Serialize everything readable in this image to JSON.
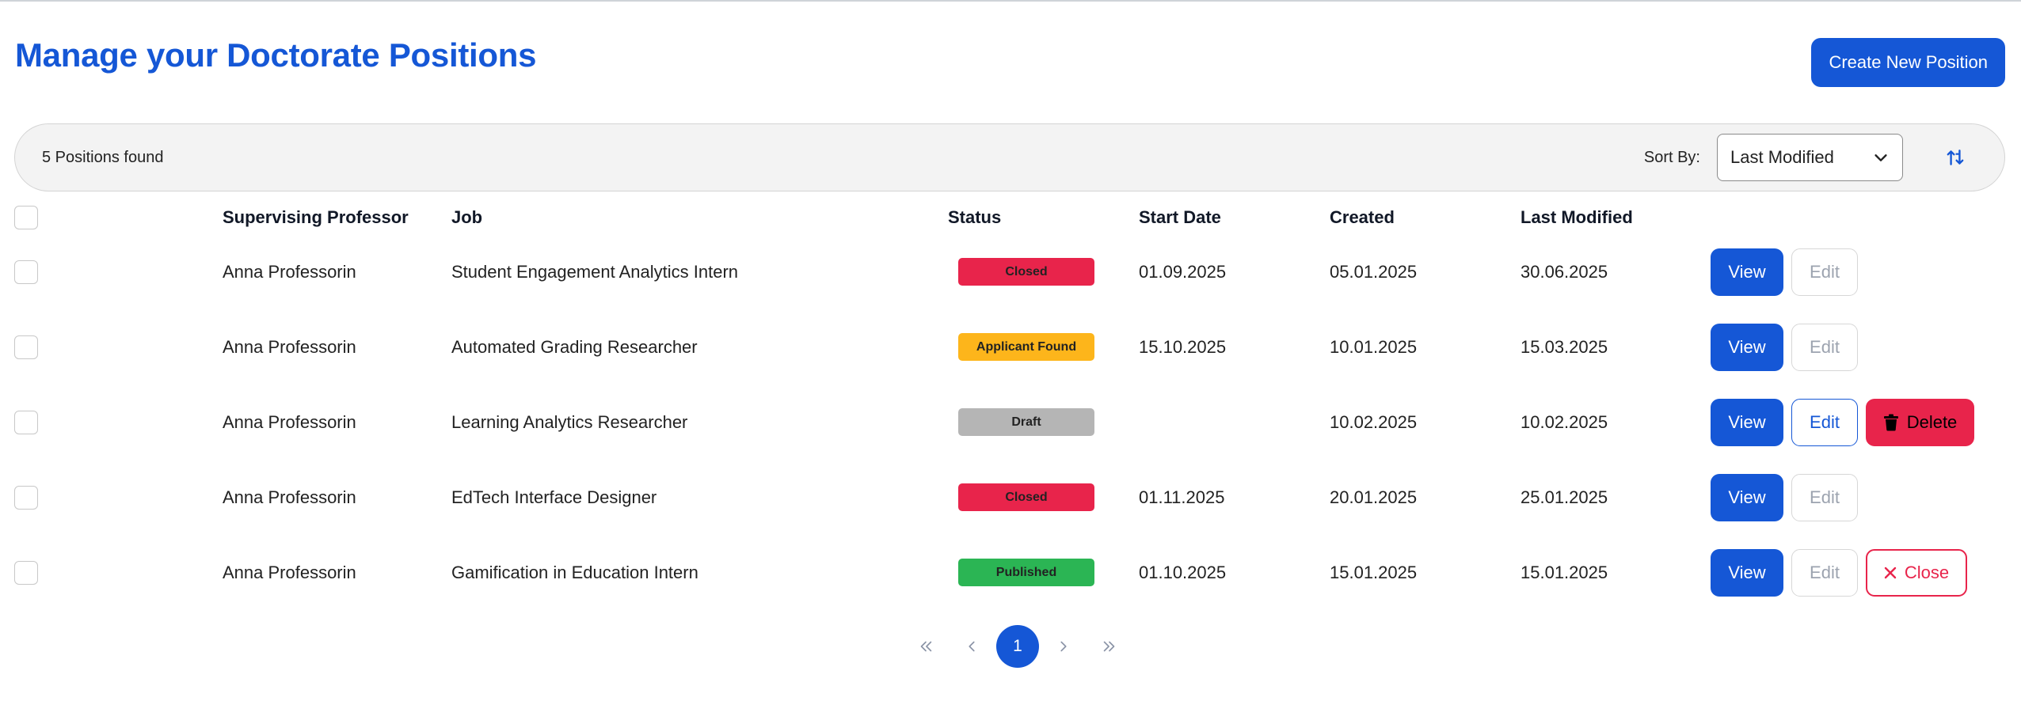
{
  "page": {
    "title": "Manage your Doctorate Positions",
    "create_button": "Create New Position"
  },
  "toolbar": {
    "count_text": "5 Positions found",
    "sort_label": "Sort By:",
    "sort_value": "Last Modified"
  },
  "table": {
    "headers": {
      "professor": "Supervising Professor",
      "job": "Job",
      "status": "Status",
      "start": "Start Date",
      "created": "Created",
      "modified": "Last Modified"
    },
    "rows": [
      {
        "professor": "Anna Professorin",
        "job": "Student Engagement Analytics Intern",
        "status": "Closed",
        "start": "01.09.2025",
        "created": "05.01.2025",
        "modified": "30.06.2025"
      },
      {
        "professor": "Anna Professorin",
        "job": "Automated Grading Researcher",
        "status": "Applicant Found",
        "start": "15.10.2025",
        "created": "10.01.2025",
        "modified": "15.03.2025"
      },
      {
        "professor": "Anna Professorin",
        "job": "Learning Analytics Researcher",
        "status": "Draft",
        "start": "",
        "created": "10.02.2025",
        "modified": "10.02.2025"
      },
      {
        "professor": "Anna Professorin",
        "job": "EdTech Interface Designer",
        "status": "Closed",
        "start": "01.11.2025",
        "created": "20.01.2025",
        "modified": "25.01.2025"
      },
      {
        "professor": "Anna Professorin",
        "job": "Gamification in Education Intern",
        "status": "Published",
        "start": "01.10.2025",
        "created": "15.01.2025",
        "modified": "15.01.2025"
      }
    ]
  },
  "actions": {
    "view": "View",
    "edit": "Edit",
    "delete": "Delete",
    "close": "Close"
  },
  "status_colors": {
    "Closed": "#e8244b",
    "Applicant Found": "#fdb51b",
    "Draft": "#b5b5b5",
    "Published": "#2bb554"
  },
  "pagination": {
    "current_page": "1"
  },
  "colors": {
    "primary": "#1557d6",
    "danger": "#e8244b"
  }
}
